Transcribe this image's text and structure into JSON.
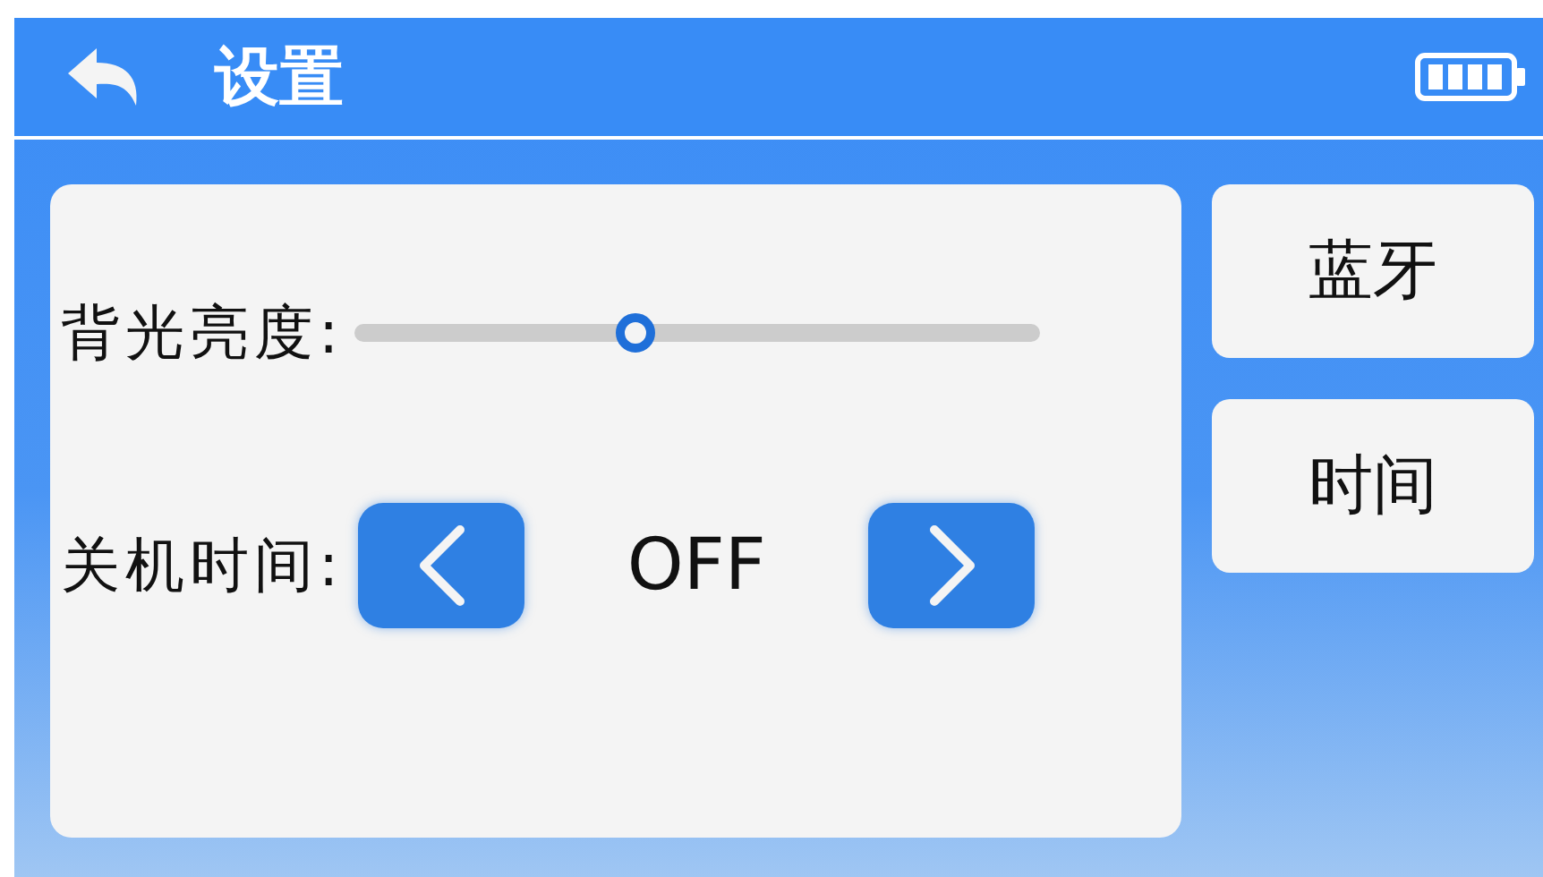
{
  "header": {
    "title": "设置"
  },
  "settings": [
    {
      "kind": "slider",
      "label": "背光亮度:",
      "level": 0.41
    },
    {
      "kind": "stepper",
      "label": "关机时间:",
      "value": "OFF"
    }
  ],
  "side_buttons": [
    "蓝牙",
    "时间"
  ]
}
